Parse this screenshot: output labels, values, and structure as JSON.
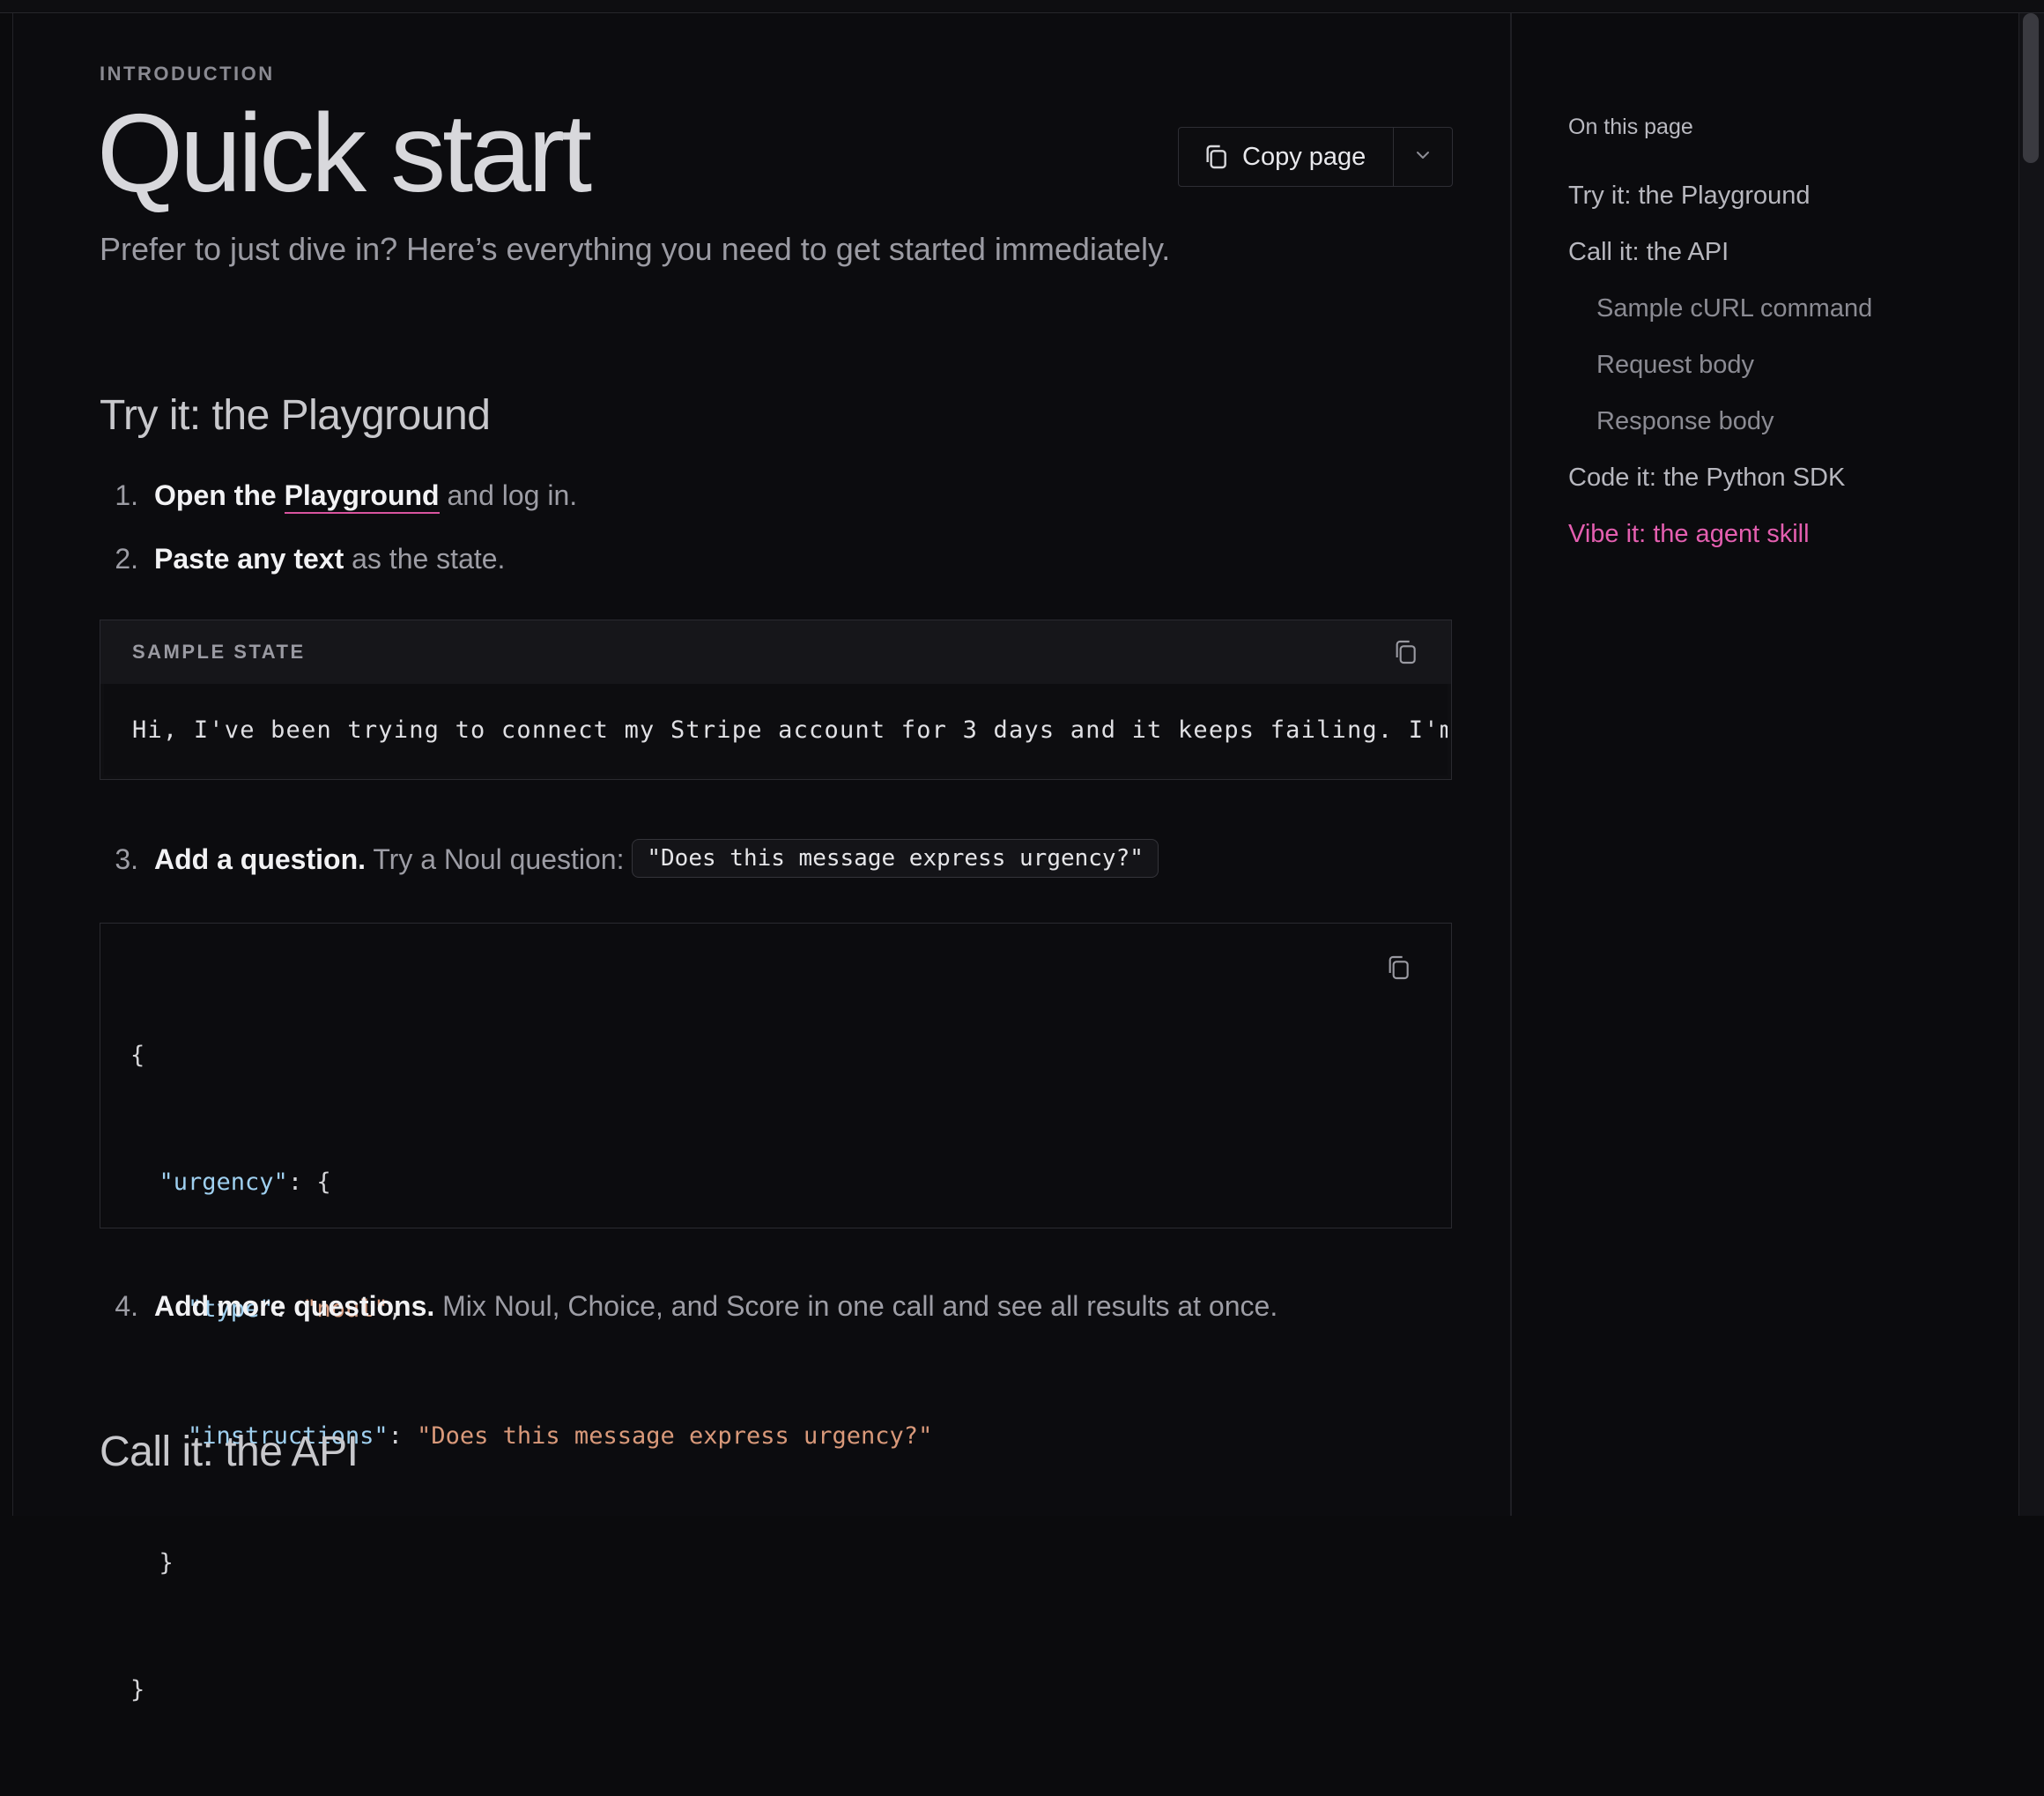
{
  "header": {
    "eyebrow": "INTRODUCTION",
    "title": "Quick start",
    "subtitle": "Prefer to just dive in? Here’s everything you need to get started immediately."
  },
  "copy_page": {
    "label": "Copy page"
  },
  "sections": {
    "playground_title": "Try it: the Playground",
    "api_title": "Call it: the API"
  },
  "steps": [
    {
      "num": "1.",
      "bold": "Open the",
      "link": "Playground",
      "rest": "and log in."
    },
    {
      "num": "2.",
      "bold": "Paste any text",
      "rest": "as the state."
    },
    {
      "num": "3.",
      "bold": "Add a question.",
      "rest": "Try a Noul question:",
      "code": "\"Does this message express urgency?\""
    },
    {
      "num": "4.",
      "bold": "Add more questions.",
      "rest": "Mix Noul, Choice, and Score in one call and see all results at once."
    }
  ],
  "sample_state": {
    "label": "SAMPLE STATE",
    "text": "Hi, I've been trying to connect my Stripe account for 3 days and it keeps failing. I'm l"
  },
  "json_block": {
    "open": "{",
    "key_urgency": "\"urgency\"",
    "colon_brace": ": {",
    "key_type": "\"type\"",
    "val_type": "\"noul\"",
    "comma": ",",
    "key_instructions": "\"instructions\"",
    "val_instructions": "\"Does this message express urgency?\"",
    "colon": ": ",
    "close_inner": "}",
    "close": "}"
  },
  "toc": {
    "heading": "On this page",
    "items": [
      {
        "label": "Try it: the Playground",
        "level": 1
      },
      {
        "label": "Call it: the API",
        "level": 1
      },
      {
        "label": "Sample cURL command",
        "level": 2
      },
      {
        "label": "Request body",
        "level": 2
      },
      {
        "label": "Response body",
        "level": 2
      },
      {
        "label": "Code it: the Python SDK",
        "level": 1
      },
      {
        "label": "Vibe it: the agent skill",
        "level": 1,
        "active": true
      }
    ]
  },
  "colors": {
    "accent": "#e45fb0",
    "background": "#0c0c0f",
    "json_key": "#9fd0f0",
    "json_string": "#d9997a"
  },
  "icons": {
    "copy": "copy-icon",
    "chevron": "chevron-down-icon"
  }
}
